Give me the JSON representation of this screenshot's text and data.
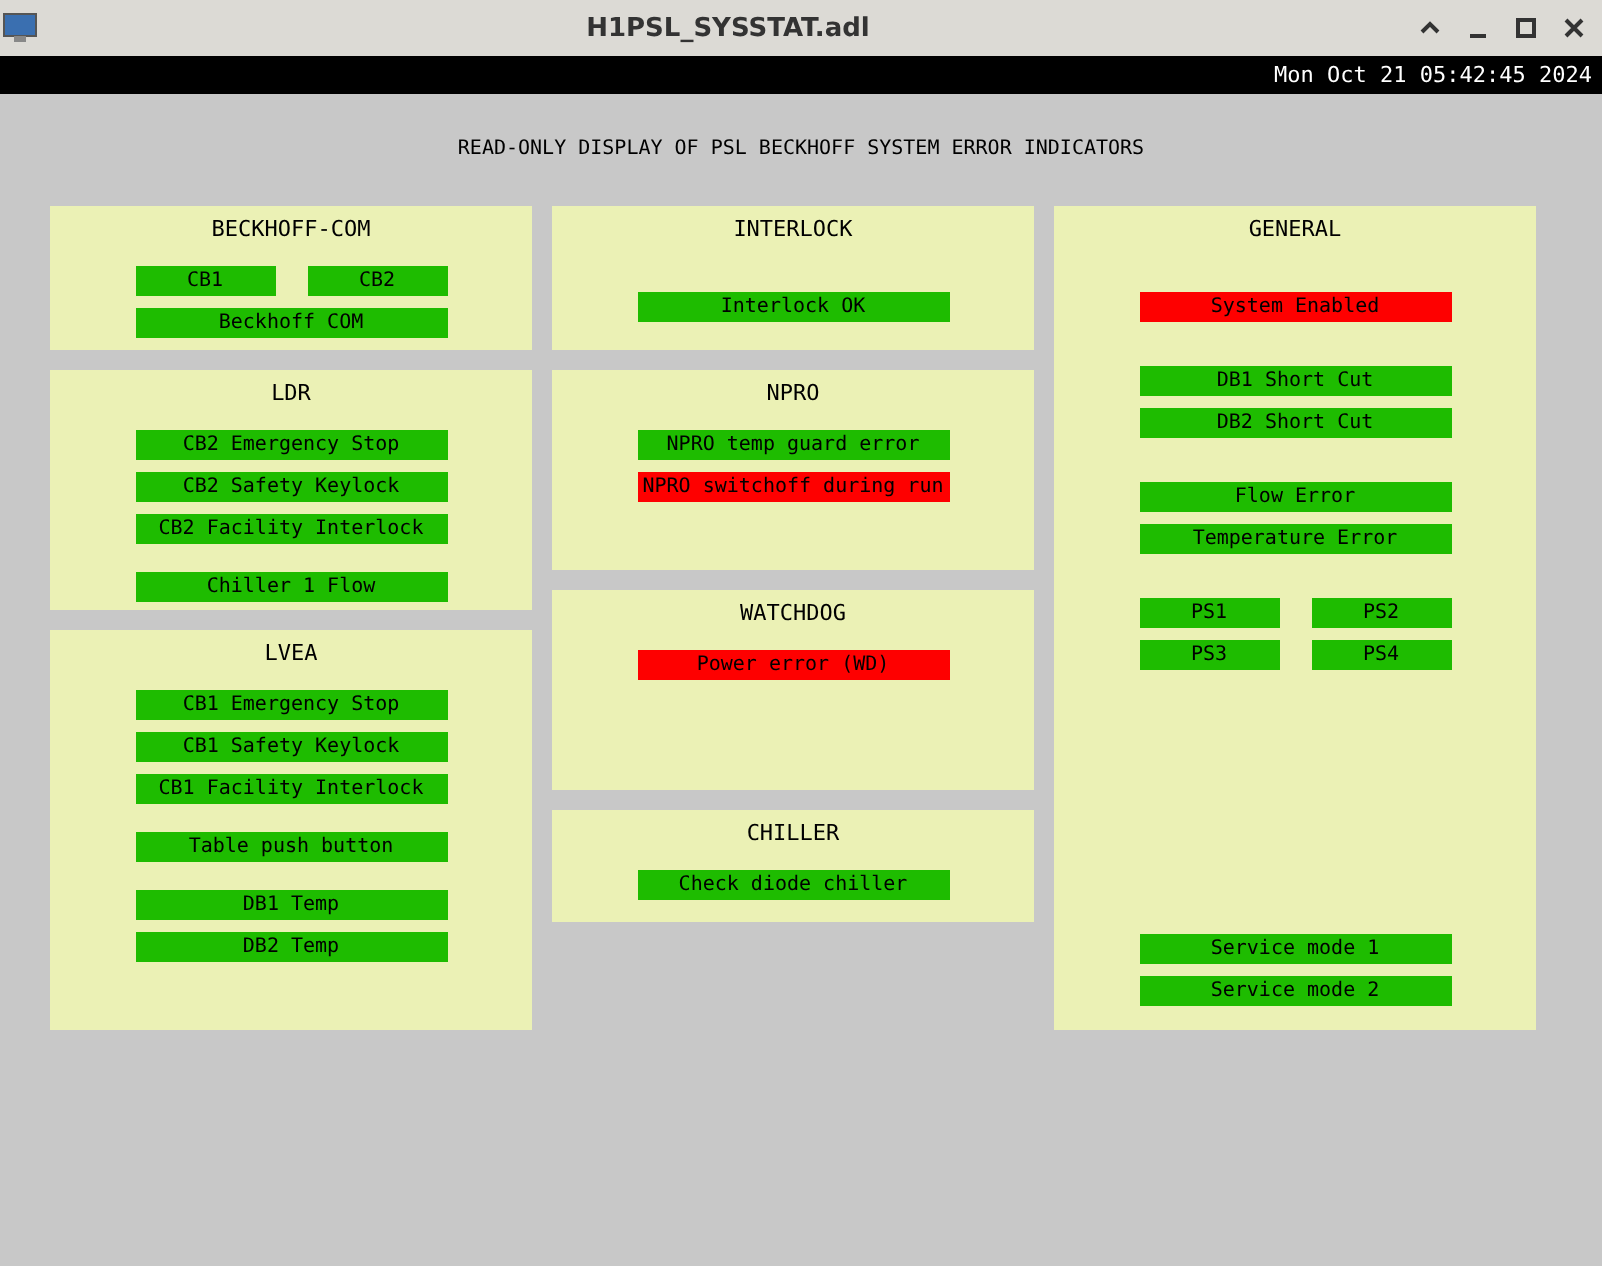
{
  "window": {
    "title": "H1PSL_SYSSTAT.adl"
  },
  "clock": "Mon Oct 21 05:42:45 2024",
  "heading": "READ-ONLY DISPLAY OF PSL BECKHOFF SYSTEM ERROR INDICATORS",
  "columns": [
    {
      "panels": [
        {
          "title": "BECKHOFF-COM",
          "groups": [
            [
              [
                {
                  "label": "CB1",
                  "alarm": false
                },
                {
                  "label": "CB2",
                  "alarm": false
                }
              ],
              [
                {
                  "label": "Beckhoff COM",
                  "alarm": false
                }
              ]
            ]
          ]
        },
        {
          "title": "LDR",
          "groups": [
            [
              [
                {
                  "label": "CB2 Emergency Stop",
                  "alarm": false
                }
              ],
              [
                {
                  "label": "CB2 Safety Keylock",
                  "alarm": false
                }
              ],
              [
                {
                  "label": "CB2 Facility Interlock",
                  "alarm": false
                }
              ]
            ],
            [
              [
                {
                  "label": "Chiller 1 Flow",
                  "alarm": false
                }
              ]
            ]
          ]
        },
        {
          "title": "LVEA",
          "groups": [
            [
              [
                {
                  "label": "CB1 Emergency Stop",
                  "alarm": false
                }
              ],
              [
                {
                  "label": "CB1 Safety Keylock",
                  "alarm": false
                }
              ],
              [
                {
                  "label": "CB1 Facility Interlock",
                  "alarm": false
                }
              ]
            ],
            [
              [
                {
                  "label": "Table push button",
                  "alarm": false
                }
              ]
            ],
            [
              [
                {
                  "label": "DB1 Temp",
                  "alarm": false
                }
              ],
              [
                {
                  "label": "DB2 Temp",
                  "alarm": false
                }
              ]
            ]
          ]
        }
      ]
    },
    {
      "panels": [
        {
          "title": "INTERLOCK",
          "groups": [
            [
              [
                {
                  "label": "Interlock OK",
                  "alarm": false
                }
              ]
            ]
          ]
        },
        {
          "title": "NPRO",
          "groups": [
            [
              [
                {
                  "label": "NPRO temp guard error",
                  "alarm": false
                }
              ],
              [
                {
                  "label": "NPRO switchoff during run",
                  "alarm": true
                }
              ]
            ]
          ]
        },
        {
          "title": "WATCHDOG",
          "groups": [
            [
              [
                {
                  "label": "Power error (WD)",
                  "alarm": true
                }
              ]
            ]
          ]
        },
        {
          "title": "CHILLER",
          "groups": [
            [
              [
                {
                  "label": "Check diode chiller",
                  "alarm": false
                }
              ]
            ]
          ]
        }
      ]
    },
    {
      "panels": [
        {
          "title": "GENERAL",
          "groups": [
            [
              [
                {
                  "label": "System Enabled",
                  "alarm": true
                }
              ]
            ],
            [
              [
                {
                  "label": "DB1 Short Cut",
                  "alarm": false
                }
              ],
              [
                {
                  "label": "DB2 Short Cut",
                  "alarm": false
                }
              ]
            ],
            [
              [
                {
                  "label": "Flow Error",
                  "alarm": false
                }
              ],
              [
                {
                  "label": "Temperature Error",
                  "alarm": false
                }
              ]
            ],
            [
              [
                {
                  "label": "PS1",
                  "alarm": false
                },
                {
                  "label": "PS2",
                  "alarm": false
                }
              ],
              [
                {
                  "label": "PS3",
                  "alarm": false
                },
                {
                  "label": "PS4",
                  "alarm": false
                }
              ]
            ],
            [
              [
                {
                  "label": "Service mode 1",
                  "alarm": false
                }
              ],
              [
                {
                  "label": "Service mode 2",
                  "alarm": false
                }
              ]
            ]
          ]
        }
      ]
    }
  ]
}
